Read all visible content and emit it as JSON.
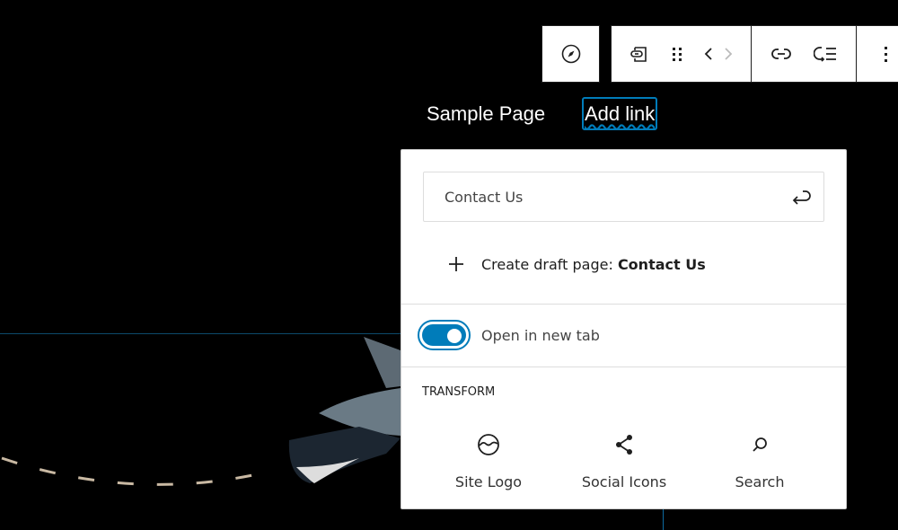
{
  "toolbar": {
    "items": [
      "compass-icon",
      "link-convert-icon",
      "drag-handle-icon",
      "chevron-left-icon",
      "chevron-right-icon",
      "link-icon",
      "add-submenu-icon",
      "more-vertical-icon"
    ]
  },
  "nav": {
    "items": [
      {
        "label": "Sample Page"
      },
      {
        "label": "Add link"
      }
    ]
  },
  "popover": {
    "search_value": "Contact Us",
    "create_prefix": "Create draft page: ",
    "create_bold": "Contact Us",
    "toggle_label": "Open in new tab",
    "toggle_on": true,
    "transform_heading": "TRANSFORM",
    "transforms": [
      {
        "label": "Site Logo"
      },
      {
        "label": "Social Icons"
      },
      {
        "label": "Search"
      }
    ]
  },
  "colors": {
    "accent": "#007cba",
    "background": "#000000"
  }
}
